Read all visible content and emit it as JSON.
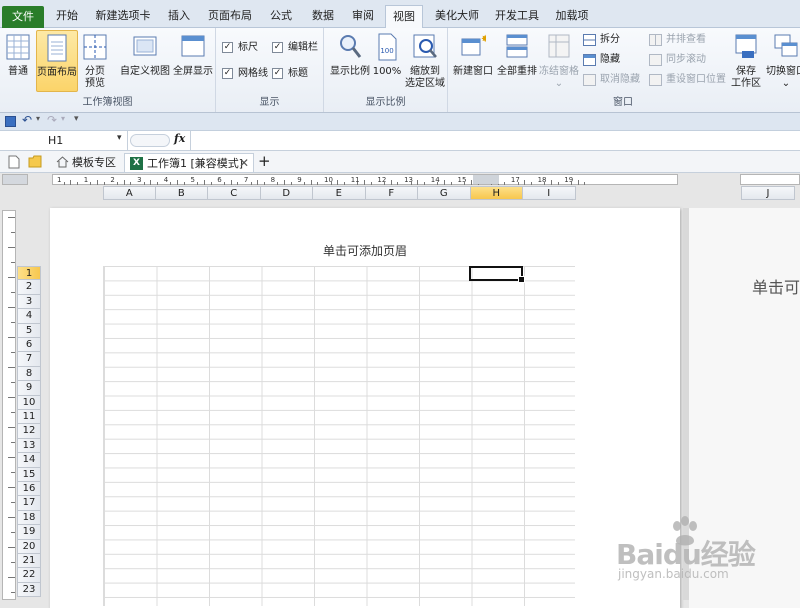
{
  "ribbon_tabs": [
    {
      "label": "文件",
      "x": 0
    },
    {
      "label": "开始"
    },
    {
      "label": "新建选项卡"
    },
    {
      "label": "插入"
    },
    {
      "label": "页面布局"
    },
    {
      "label": "公式"
    },
    {
      "label": "数据"
    },
    {
      "label": "审阅"
    },
    {
      "label": "视图"
    },
    {
      "label": "美化大师"
    },
    {
      "label": "开发工具"
    },
    {
      "label": "加载项"
    }
  ],
  "workbook_views": {
    "group_label": "工作簿视图",
    "normal": "普通",
    "page_layout": "页面布局",
    "page_break_line1": "分页",
    "page_break_line2": "预览",
    "custom_views": "自定义视图",
    "full_screen": "全屏显示"
  },
  "show": {
    "group_label": "显示",
    "ruler": "标尺",
    "formula_bar": "编辑栏",
    "gridlines": "网格线",
    "headings": "标题"
  },
  "zoom": {
    "group_label": "显示比例",
    "zoom": "显示比例",
    "zoom_100": "100%",
    "zoom_selection_line1": "缩放到",
    "zoom_selection_line2": "选定区域"
  },
  "window": {
    "group_label": "窗口",
    "new_window": "新建窗口",
    "arrange_all": "全部重排",
    "freeze_panes": "冻结窗格",
    "split": "拆分",
    "hide": "隐藏",
    "unhide": "取消隐藏",
    "side_by_side": "并排查看",
    "sync_scroll": "同步滚动",
    "reset_position": "重设窗口位置",
    "save_workspace_line1": "保存",
    "save_workspace_line2": "工作区",
    "switch_windows": "切换窗口"
  },
  "name_box": "H1",
  "fx_label": "fx",
  "doc_tabs": {
    "template_zone": "模板专区",
    "workbook": "工作簿1 [兼容模式]",
    "new_tab": "+"
  },
  "columns": [
    "A",
    "B",
    "C",
    "D",
    "E",
    "F",
    "G",
    "H",
    "I"
  ],
  "next_page_column": "J",
  "selected_column": "H",
  "rows": [
    "1",
    "2",
    "3",
    "4",
    "5",
    "6",
    "7",
    "8",
    "9",
    "10",
    "11",
    "12",
    "13",
    "14",
    "15",
    "16",
    "17",
    "18",
    "19",
    "20",
    "21",
    "22",
    "23"
  ],
  "selected_row": "1",
  "header_placeholder": "单击可添加页眉",
  "next_page_header_partial": "单击可",
  "ruler_numbers": [
    "1",
    "1",
    "2",
    "3",
    "4",
    "5",
    "6",
    "7",
    "8",
    "9",
    "10",
    "11",
    "12",
    "13",
    "14",
    "15",
    "16",
    "17",
    "18",
    "19"
  ],
  "watermark": {
    "brand": "Baidu经验",
    "url": "jingyan.baidu.com"
  }
}
